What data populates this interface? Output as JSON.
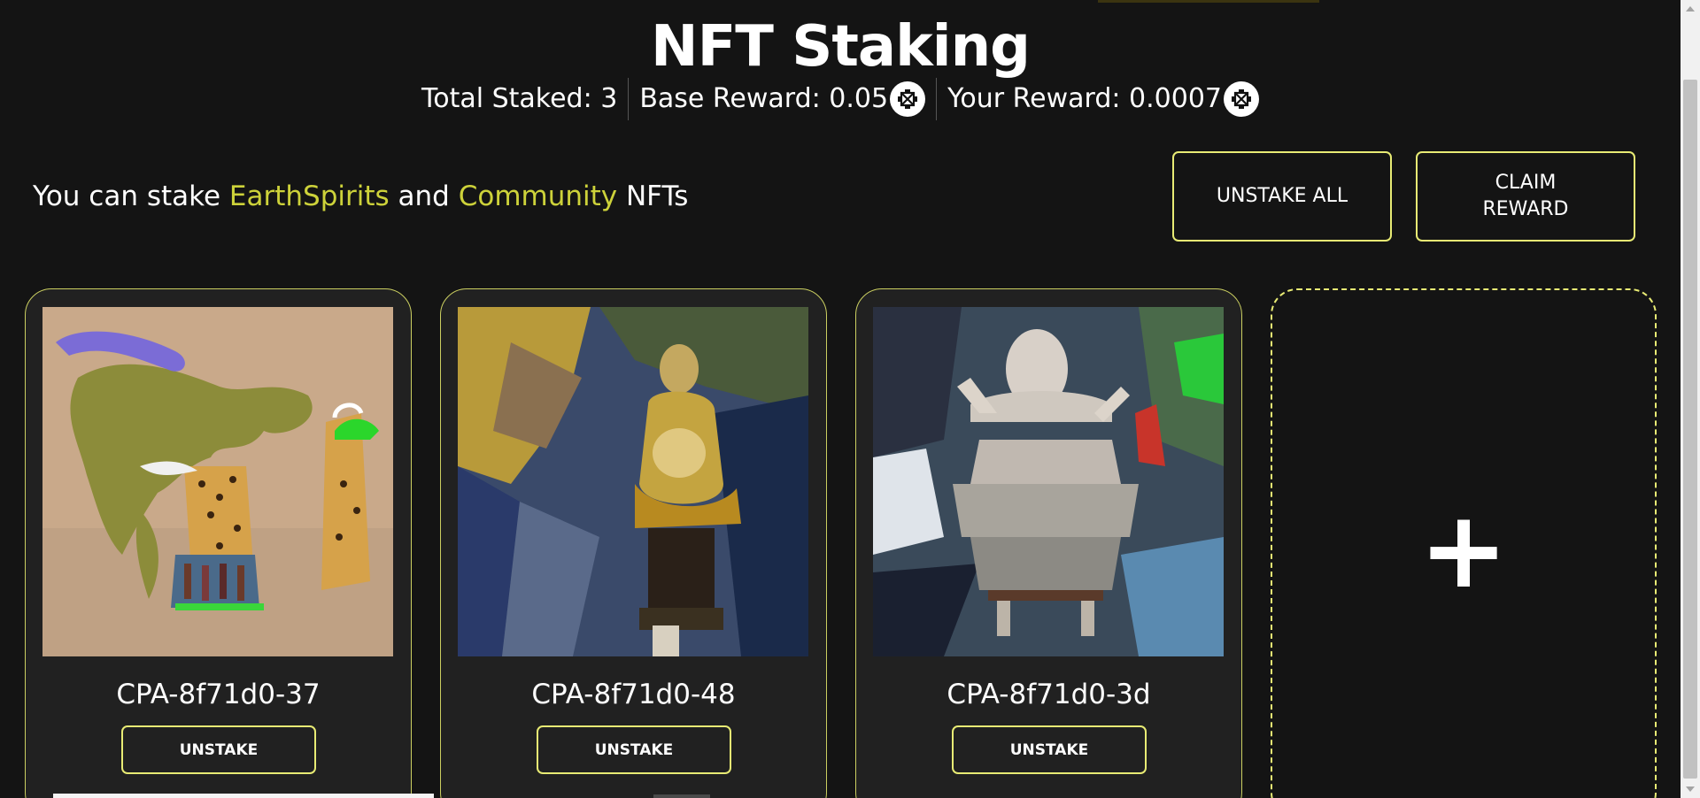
{
  "header": {
    "title": "NFT Staking",
    "total_staked": "Total Staked: 3",
    "base_reward": "Base Reward: 0.05",
    "your_reward": "Your Reward: 0.0007",
    "token_icon": "token-coin-icon"
  },
  "intro": {
    "prefix": "You can stake ",
    "collection_1": "EarthSpirits",
    "connector": " and ",
    "collection_2": "Community",
    "suffix": " NFTs"
  },
  "actions": {
    "unstake_all": "UNSTAKE ALL",
    "claim_reward": "CLAIM REWARD"
  },
  "nfts": [
    {
      "name": "CPA-8f71d0-37",
      "button": "UNSTAKE"
    },
    {
      "name": "CPA-8f71d0-48",
      "button": "UNSTAKE"
    },
    {
      "name": "CPA-8f71d0-3d",
      "button": "UNSTAKE"
    }
  ],
  "add_card": {
    "symbol": "+"
  },
  "colors": {
    "background": "#141414",
    "card": "#212121",
    "accent": "#e8eb74",
    "highlight_text": "#cdd23a"
  }
}
